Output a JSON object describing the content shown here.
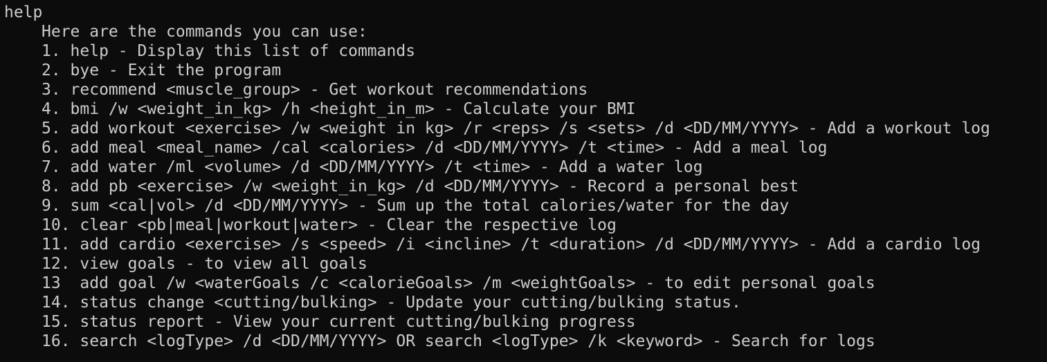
{
  "terminal": {
    "prompt_command": "help",
    "intro": "Here are the commands you can use:",
    "commands": [
      "1. help - Display this list of commands",
      "2. bye - Exit the program",
      "3. recommend <muscle_group> - Get workout recommendations",
      "4. bmi /w <weight_in_kg> /h <height_in_m> - Calculate your BMI",
      "5. add workout <exercise> /w <weight in kg> /r <reps> /s <sets> /d <DD/MM/YYYY> - Add a workout log",
      "6. add meal <meal_name> /cal <calories> /d <DD/MM/YYYY> /t <time> - Add a meal log",
      "7. add water /ml <volume> /d <DD/MM/YYYY> /t <time> - Add a water log",
      "8. add pb <exercise> /w <weight_in_kg> /d <DD/MM/YYYY> - Record a personal best",
      "9. sum <cal|vol> /d <DD/MM/YYYY> - Sum up the total calories/water for the day",
      "10. clear <pb|meal|workout|water> - Clear the respective log",
      "11. add cardio <exercise> /s <speed> /i <incline> /t <duration> /d <DD/MM/YYYY> - Add a cardio log",
      "12. view goals - to view all goals",
      "13  add goal /w <waterGoals /c <calorieGoals> /m <weightGoals> - to edit personal goals",
      "14. status change <cutting/bulking> - Update your cutting/bulking status.",
      "15. status report - View your current cutting/bulking progress",
      "16. search <logType> /d <DD/MM/YYYY> OR search <logType> /k <keyword> - Search for logs"
    ]
  }
}
